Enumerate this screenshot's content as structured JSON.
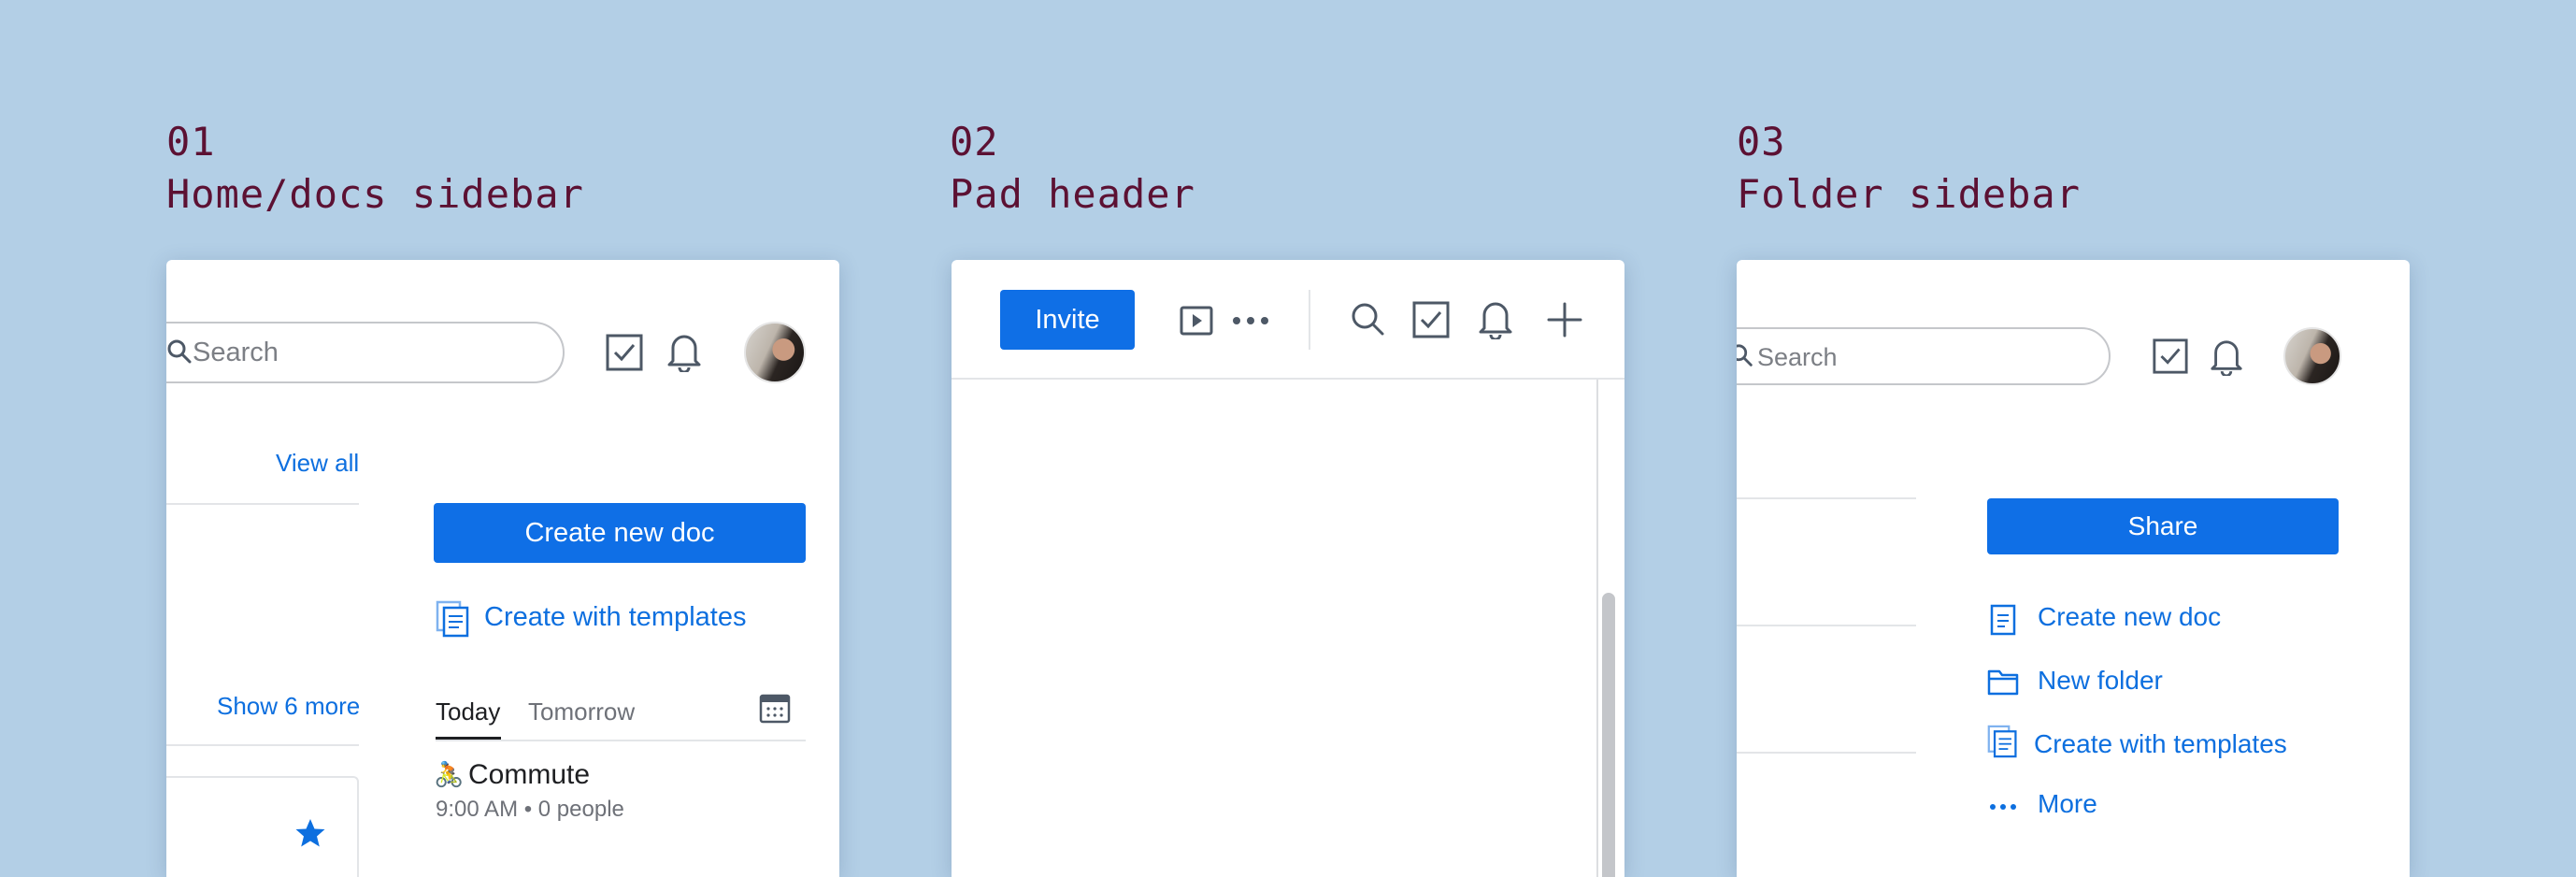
{
  "sections": [
    {
      "number": "01",
      "title": "Home/docs sidebar"
    },
    {
      "number": "02",
      "title": "Pad header"
    },
    {
      "number": "03",
      "title": "Folder sidebar"
    }
  ],
  "home": {
    "search_placeholder": "Search",
    "view_all": "View all",
    "create_new_doc": "Create new doc",
    "create_with_templates": "Create with templates",
    "show_more": "Show 6 more",
    "tabs": [
      "Today",
      "Tomorrow"
    ],
    "event": {
      "emoji": "🚴",
      "title": "Commute",
      "meta": "9:00 AM • 0 people"
    }
  },
  "pad": {
    "invite_label": "Invite"
  },
  "folder": {
    "search_placeholder": "Search",
    "share_label": "Share",
    "actions": [
      "Create new doc",
      "New folder",
      "Create with templates",
      "More"
    ]
  },
  "colors": {
    "background": "#b3cfe6",
    "label": "#5c1133",
    "accent": "#0f6fe6",
    "link": "#0d6fdf",
    "icon": "#4d5866"
  }
}
